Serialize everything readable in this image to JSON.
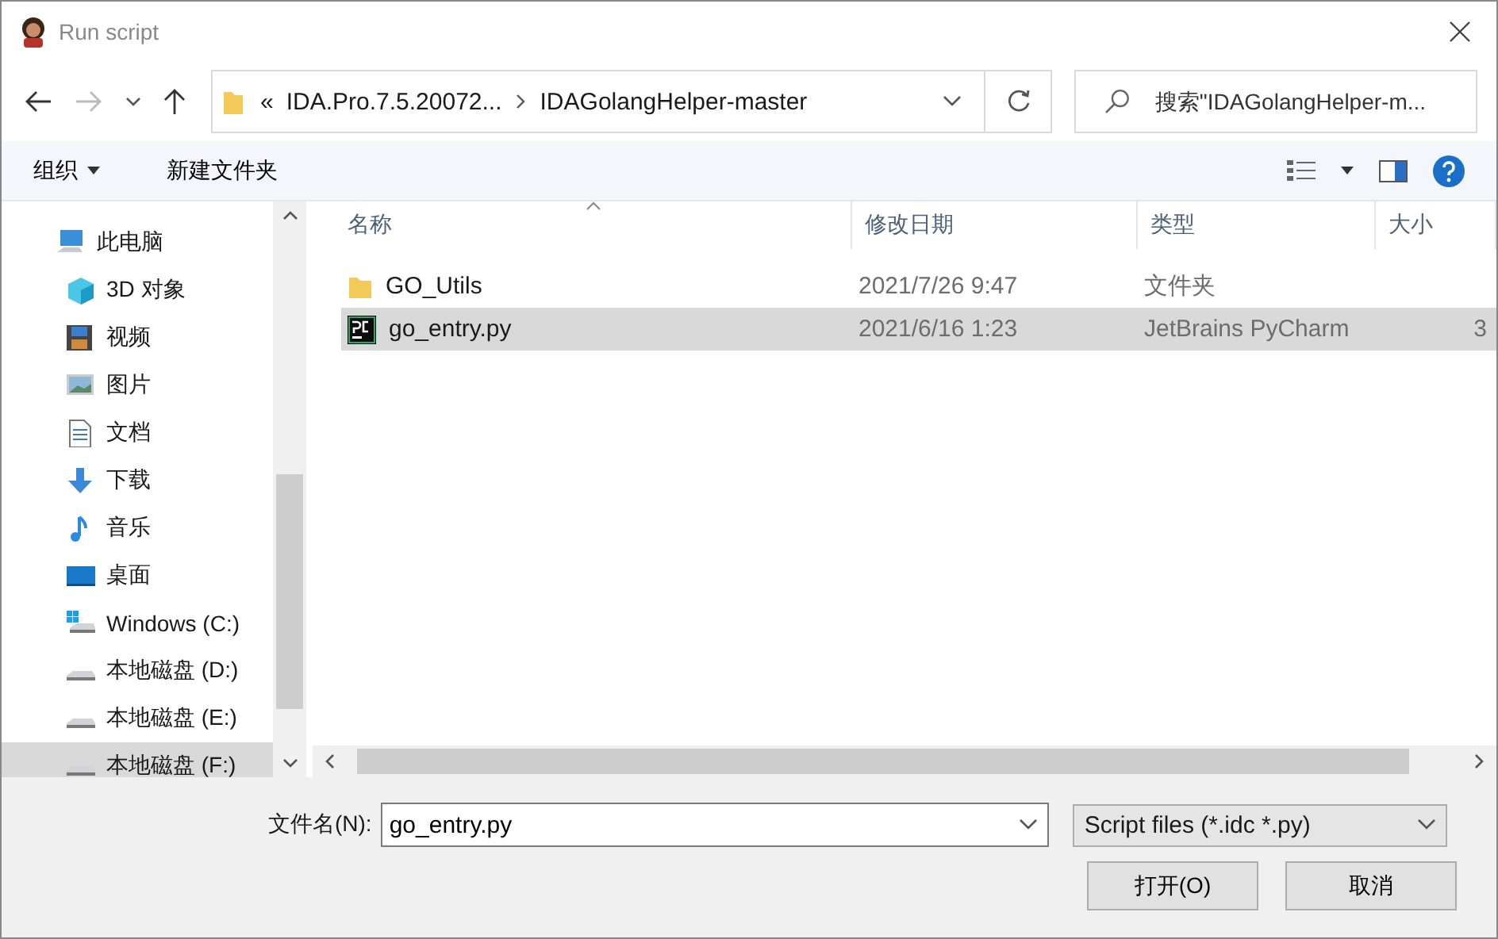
{
  "window": {
    "title": "Run script"
  },
  "address": {
    "path": [
      {
        "label": "«",
        "kind": "overflow"
      },
      {
        "label": "IDA.Pro.7.5.20072...",
        "kind": "folder"
      },
      {
        "label": "IDAGolangHelper-master",
        "kind": "folder"
      }
    ]
  },
  "search": {
    "placeholder": "搜索\"IDAGolangHelper-m..."
  },
  "toolbar": {
    "items": [
      "组织",
      "新建文件夹"
    ]
  },
  "sidebar": {
    "items": [
      {
        "label": "此电脑",
        "kind": "pc",
        "selected": false,
        "children": [
          {
            "label": "3D 对象",
            "kind": "cube",
            "selected": false
          },
          {
            "label": "视频",
            "kind": "video",
            "selected": false
          },
          {
            "label": "图片",
            "kind": "picture",
            "selected": false
          },
          {
            "label": "文档",
            "kind": "document",
            "selected": false
          },
          {
            "label": "下载",
            "kind": "download",
            "selected": false
          },
          {
            "label": "音乐",
            "kind": "music",
            "selected": false
          },
          {
            "label": "桌面",
            "kind": "desktop",
            "selected": false
          },
          {
            "label": "Windows (C:)",
            "kind": "system-drive",
            "selected": false
          },
          {
            "label": "本地磁盘 (D:)",
            "kind": "drive",
            "selected": false
          },
          {
            "label": "本地磁盘 (E:)",
            "kind": "drive",
            "selected": false
          },
          {
            "label": "本地磁盘 (F:)",
            "kind": "drive",
            "selected": true
          }
        ]
      }
    ]
  },
  "table": {
    "columns": [
      "名称",
      "修改日期",
      "类型",
      "大小"
    ],
    "rows": [
      {
        "kind": "folder",
        "name": "GO_Utils",
        "date": "2021/7/26 9:47",
        "type": "文件夹",
        "selected": false
      },
      {
        "kind": "pycharm",
        "name": "go_entry.py",
        "date": "2021/6/16 1:23",
        "type": "JetBrains PyCharm",
        "size": "3",
        "selected": true
      }
    ]
  },
  "file_name": {
    "label": "文件名(N):",
    "value": "go_entry.py"
  },
  "file_type": {
    "value": "Script files (*.idc *.py)"
  },
  "buttons": [
    "打开(O)",
    "取消"
  ]
}
